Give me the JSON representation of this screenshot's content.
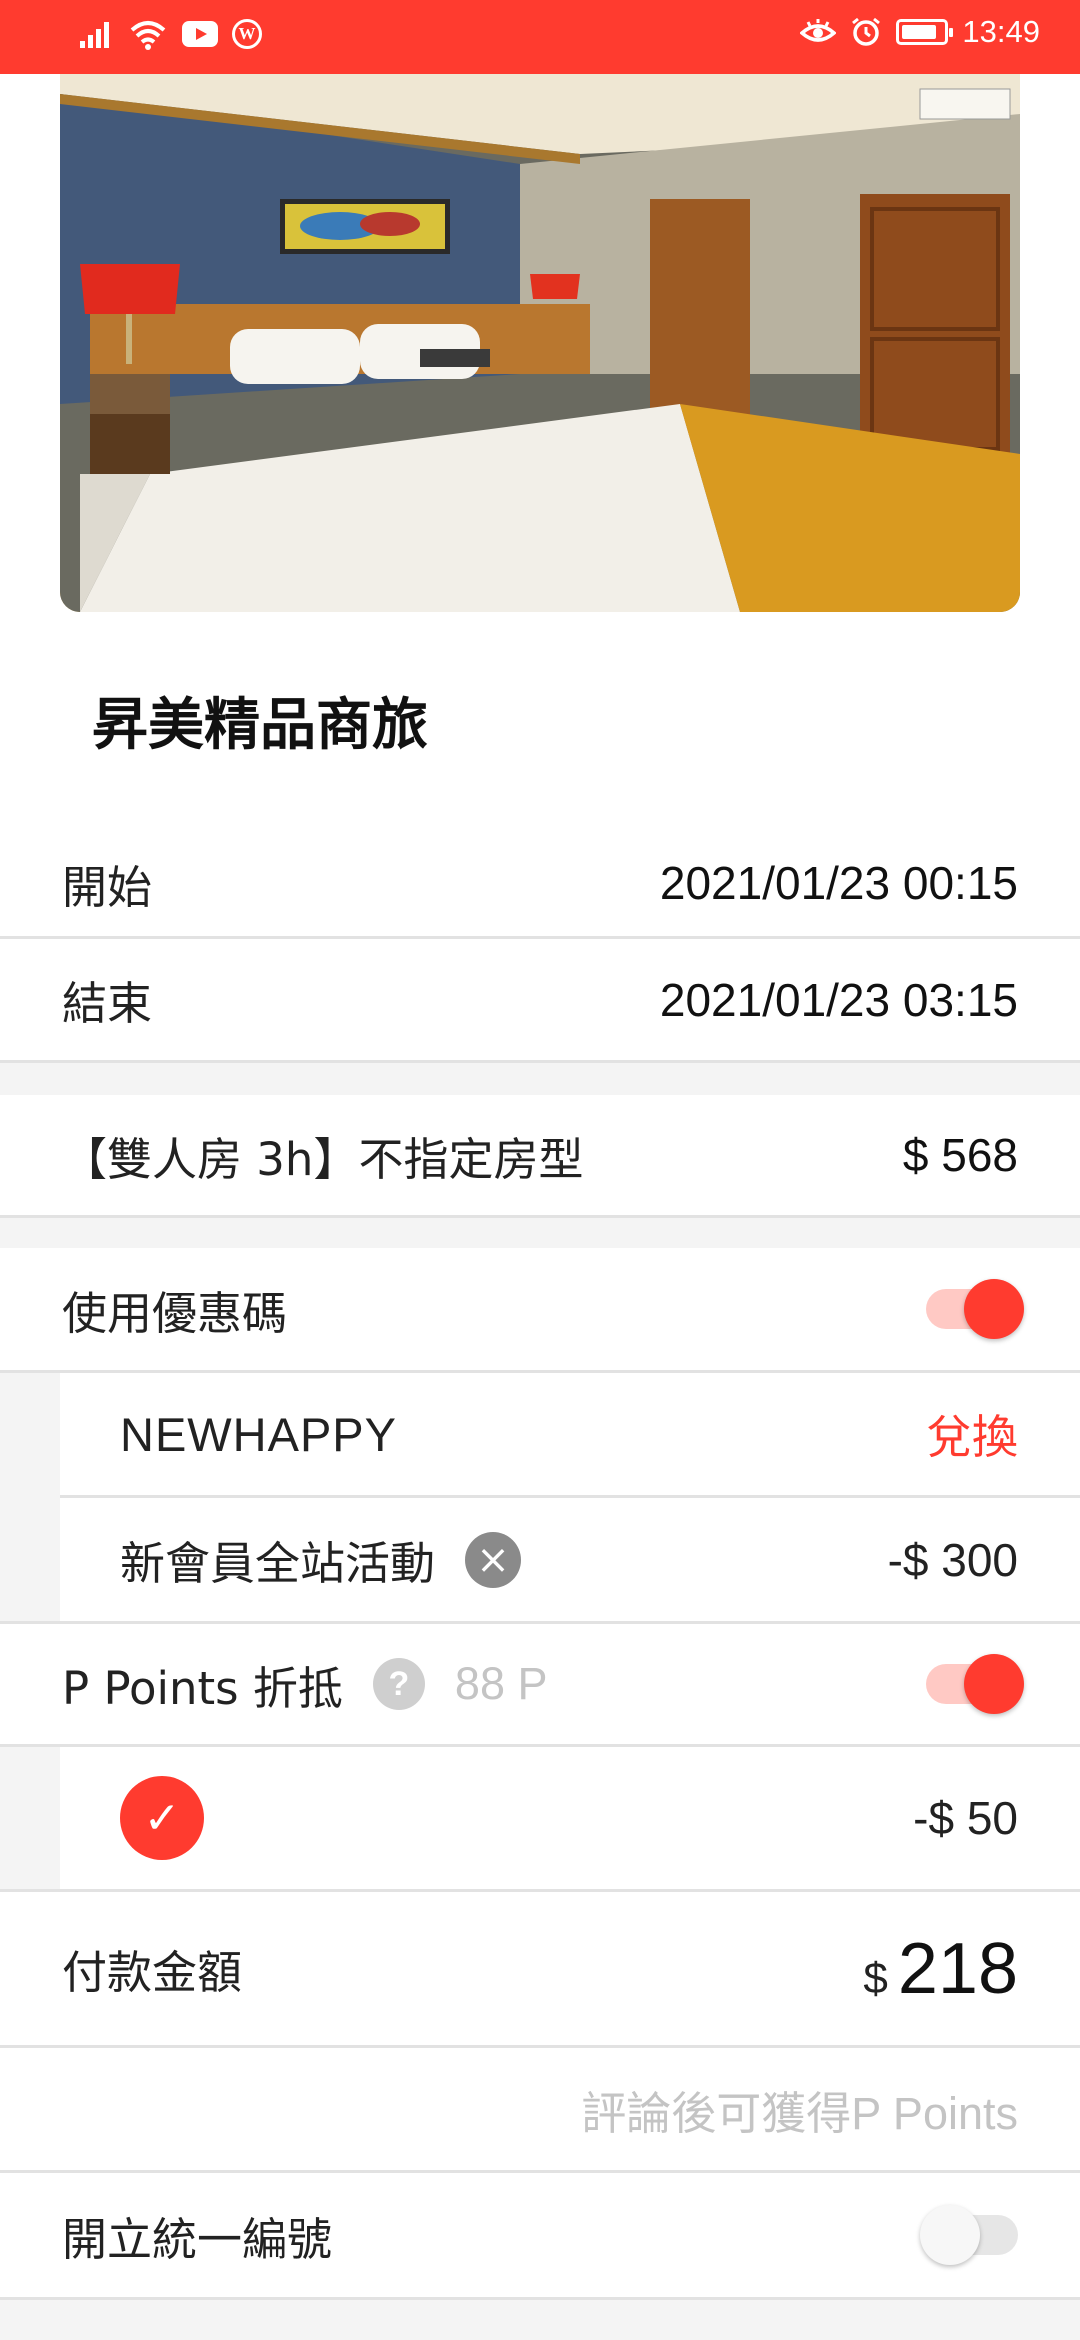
{
  "status_bar": {
    "time": "13:49",
    "wordpress_letter": "W"
  },
  "hotel": {
    "name": "昇美精品商旅"
  },
  "booking": {
    "start": {
      "label": "開始",
      "value": "2021/01/23 00:15"
    },
    "end": {
      "label": "結束",
      "value": "2021/01/23 03:15"
    },
    "room": {
      "label": "【雙人房 3h】不指定房型",
      "price": "$ 568"
    }
  },
  "coupon": {
    "label": "使用優惠碼",
    "enabled": true,
    "code": "NEWHAPPY",
    "redeem_label": "兌換",
    "campaign": "新會員全站活動",
    "discount": "-$ 300"
  },
  "points": {
    "label": "P Points 折抵",
    "balance": "88 P",
    "enabled": true,
    "discount": "-$ 50",
    "help_glyph": "?"
  },
  "payment": {
    "label": "付款金額",
    "currency": "$",
    "amount": "218",
    "review_note": "評論後可獲得P Points"
  },
  "invoice": {
    "label": "開立統一編號",
    "enabled": false
  },
  "colors": {
    "accent": "#ff3b2f",
    "muted": "#c4c4c4",
    "divider": "#e2e2e2"
  },
  "icons": [
    "signal-icon",
    "wifi-icon",
    "youtube-icon",
    "wordpress-icon",
    "eye-icon",
    "alarm-icon",
    "battery-icon",
    "clear-icon",
    "help-icon",
    "check-icon"
  ]
}
